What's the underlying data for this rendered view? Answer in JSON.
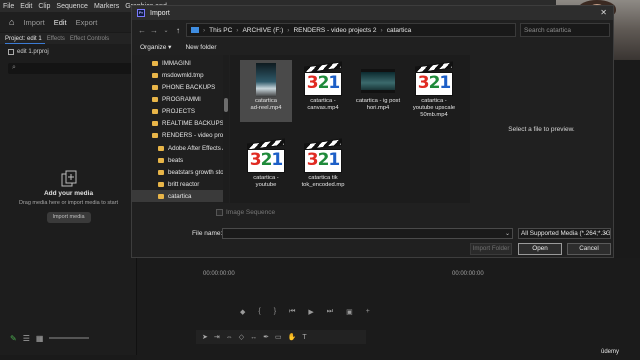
{
  "app": {
    "menu": [
      "File",
      "Edit",
      "Clip",
      "Sequence",
      "Markers",
      "Graphics and"
    ],
    "workspace_tabs": [
      "Import",
      "Edit",
      "Export"
    ],
    "active_workspace": "Edit"
  },
  "project_panel": {
    "tabs": [
      "Project: edit 1",
      "Effects",
      "Effect Controls"
    ],
    "file_name": "edit 1.prproj",
    "empty_title": "Add your media",
    "empty_subtitle": "Drag media here or import media to start",
    "import_button": "Import media"
  },
  "timeline": {
    "timecode_left": "00:00:00:00",
    "timecode_right": "00:00:00:00"
  },
  "watermark": "ûdemy",
  "dialog": {
    "title": "Import",
    "close_glyph": "✕",
    "breadcrumbs": [
      "This PC",
      "ARCHIVE (F:)",
      "RENDERS - video projects 2",
      "catartica"
    ],
    "search_placeholder": "Search catartica",
    "organize_label": "Organize ▾",
    "new_folder_label": "New folder",
    "nav_items": [
      {
        "label": "IMMAGINI",
        "indent": false,
        "selected": false
      },
      {
        "label": "msdowmld.tmp",
        "indent": false,
        "selected": false
      },
      {
        "label": "PHONE BACKUPS",
        "indent": false,
        "selected": false
      },
      {
        "label": "PROGRAMMI",
        "indent": false,
        "selected": false
      },
      {
        "label": "PROJECTS",
        "indent": false,
        "selected": false
      },
      {
        "label": "REALTIME BACKUPS - c",
        "indent": false,
        "selected": false
      },
      {
        "label": "RENDERS - video proj",
        "indent": false,
        "selected": false
      },
      {
        "label": "Adobe After Effects A",
        "indent": true,
        "selected": false
      },
      {
        "label": "beats",
        "indent": true,
        "selected": false
      },
      {
        "label": "beatstars growth stor",
        "indent": true,
        "selected": false
      },
      {
        "label": "britt reactor",
        "indent": true,
        "selected": false
      },
      {
        "label": "catartica",
        "indent": true,
        "selected": true
      }
    ],
    "files": [
      {
        "name_lines": [
          "catartica",
          "ad-reel.mp4"
        ],
        "thumb": "portrait-video",
        "selected": true
      },
      {
        "name_lines": [
          "catartica -",
          "canvas.mp4"
        ],
        "thumb": "vlc",
        "selected": false
      },
      {
        "name_lines": [
          "catartica - ig post",
          "hori.mp4"
        ],
        "thumb": "landscape-video",
        "selected": false
      },
      {
        "name_lines": [
          "catartica -",
          "youtube upscale",
          "50mb.mp4"
        ],
        "thumb": "vlc",
        "selected": false
      },
      {
        "name_lines": [
          "catartica -",
          "youtube"
        ],
        "thumb": "vlc",
        "selected": false
      },
      {
        "name_lines": [
          "catartica tik",
          "tok_encoded.mp"
        ],
        "thumb": "vlc",
        "selected": false
      }
    ],
    "preview_text": "Select a file to preview.",
    "image_sequence_label": "Image Sequence",
    "file_name_label": "File name:",
    "file_name_value": "",
    "file_type": "All Supported Media (*.264;*.3G",
    "import_folder_label": "Import Folder",
    "open_label": "Open",
    "cancel_label": "Cancel",
    "vlc_digits": [
      "3",
      "2",
      "1"
    ],
    "colors": {
      "folder": "#e8b548",
      "accent": "#3b7bd4"
    }
  }
}
